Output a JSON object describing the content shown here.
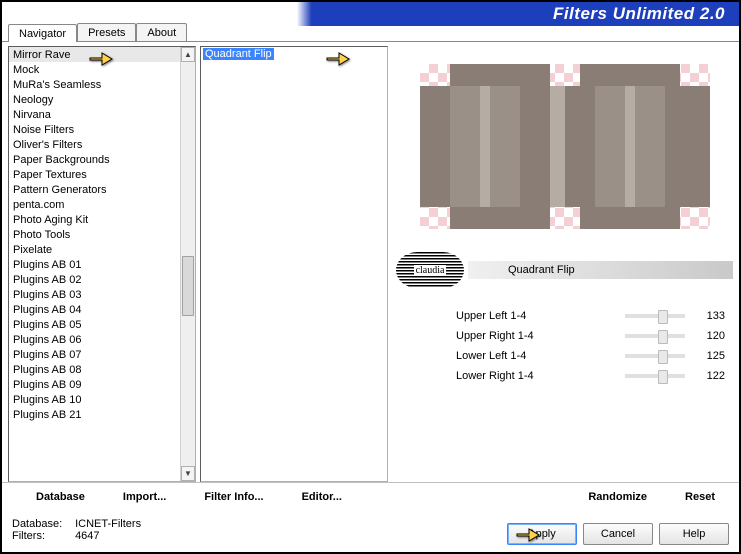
{
  "header": {
    "title": "Filters Unlimited 2.0"
  },
  "tabs": [
    "Navigator",
    "Presets",
    "About"
  ],
  "activeTab": 0,
  "categories": [
    "Mirror Rave",
    "Mock",
    "MuRa's Seamless",
    "Neology",
    "Nirvana",
    "Noise Filters",
    "Oliver's Filters",
    "Paper Backgrounds",
    "Paper Textures",
    "Pattern Generators",
    "penta.com",
    "Photo Aging Kit",
    "Photo Tools",
    "Pixelate",
    "Plugins AB 01",
    "Plugins AB 02",
    "Plugins AB 03",
    "Plugins AB 04",
    "Plugins AB 05",
    "Plugins AB 06",
    "Plugins AB 07",
    "Plugins AB 08",
    "Plugins AB 09",
    "Plugins AB 10",
    "Plugins AB 21"
  ],
  "selectedCategory": "Mirror Rave",
  "filters": [
    "Quadrant Flip"
  ],
  "selectedFilter": "Quadrant Flip",
  "logoText": "claudia",
  "paramTitle": "Quadrant Flip",
  "params": [
    {
      "label": "Upper Left 1-4",
      "value": 133
    },
    {
      "label": "Upper Right 1-4",
      "value": 120
    },
    {
      "label": "Lower Left 1-4",
      "value": 125
    },
    {
      "label": "Lower Right 1-4",
      "value": 122
    }
  ],
  "linkRow": {
    "database": "Database",
    "import": "Import...",
    "filterInfo": "Filter Info...",
    "editor": "Editor...",
    "randomize": "Randomize",
    "reset": "Reset"
  },
  "status": {
    "dbLabel": "Database:",
    "dbValue": "ICNET-Filters",
    "filtersLabel": "Filters:",
    "filtersValue": "4647"
  },
  "buttons": {
    "apply": "Apply",
    "cancel": "Cancel",
    "help": "Help"
  }
}
